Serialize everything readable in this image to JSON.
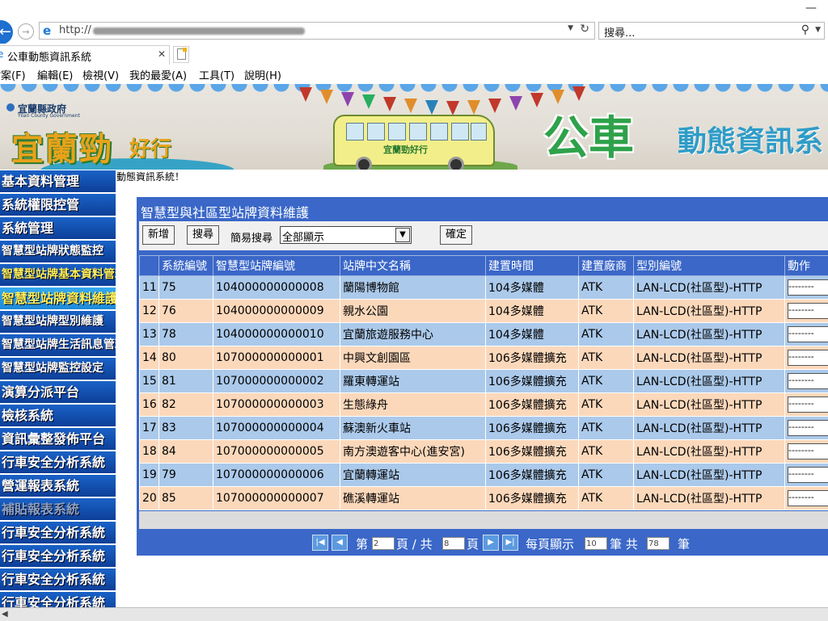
{
  "browser": {
    "address": {
      "prefix": "http://"
    },
    "search": {
      "placeholder": "搜尋..."
    },
    "tab": {
      "title": "公車動態資訊系統"
    },
    "menu": [
      "檔案(F)",
      "編輯(E)",
      "檢視(V)",
      "我的最愛(A)",
      "工具(T)",
      "說明(H)"
    ]
  },
  "banner": {
    "gov_name": "宜蘭縣政府",
    "gov_name_en": "Yilan County Government",
    "logo_main": "宜蘭",
    "logo_brand": "勁",
    "logo_sub": "好行",
    "bus_label": "宜蘭勁好行",
    "title_big": "公車",
    "title_rest": "動態資訊系"
  },
  "sidebar": {
    "items": [
      {
        "label": "基本資料管理",
        "style": "normal"
      },
      {
        "label": "系統權限控管",
        "style": "normal"
      },
      {
        "label": "系統管理",
        "style": "normal"
      },
      {
        "label": "智慧型站牌狀態監控",
        "style": "small"
      },
      {
        "label": "智慧型站牌基本資料管理",
        "style": "yellow-small"
      },
      {
        "label": "智慧型站牌資料維護",
        "style": "highlight"
      },
      {
        "label": "智慧型站牌型別維護",
        "style": "small"
      },
      {
        "label": "智慧型站牌生活訊息管理",
        "style": "small"
      },
      {
        "label": "智慧型站牌監控設定",
        "style": "small"
      },
      {
        "label": "演算分派平台",
        "style": "normal"
      },
      {
        "label": "檢核系統",
        "style": "normal"
      },
      {
        "label": "資訊彙整發佈平台",
        "style": "normal"
      },
      {
        "label": "行車安全分析系統",
        "style": "normal"
      },
      {
        "label": "營運報表系統",
        "style": "normal"
      },
      {
        "label": "補貼報表系統",
        "style": "disabled"
      },
      {
        "label": "行車安全分析系統",
        "style": "normal"
      },
      {
        "label": "行車安全分析系統",
        "style": "normal"
      },
      {
        "label": "行車安全分析系統",
        "style": "normal"
      },
      {
        "label": "行車安全分析系統",
        "style": "normal"
      }
    ]
  },
  "main": {
    "welcome": "動態資訊系統！",
    "panel_title": "智慧型與社區型站牌資料維護",
    "toolbar": {
      "add_label": "新增",
      "search_label": "搜尋",
      "quick_search_label": "簡易搜尋",
      "quick_search_value": "全部顯示",
      "confirm_label": "確定"
    },
    "table": {
      "headers": [
        "",
        "系統編號",
        "智慧型站牌編號",
        "站牌中文名稱",
        "建置時間",
        "建置廠商",
        "型別編號",
        "動作"
      ],
      "rows": [
        [
          "11",
          "75",
          "104000000000008",
          "蘭陽博物館",
          "104多媒體",
          "ATK",
          "LAN-LCD(社區型)-HTTP",
          "--------"
        ],
        [
          "12",
          "76",
          "104000000000009",
          "親水公園",
          "104多媒體",
          "ATK",
          "LAN-LCD(社區型)-HTTP",
          "--------"
        ],
        [
          "13",
          "78",
          "104000000000010",
          "宜蘭旅遊服務中心",
          "104多媒體",
          "ATK",
          "LAN-LCD(社區型)-HTTP",
          "--------"
        ],
        [
          "14",
          "80",
          "107000000000001",
          "中興文創園區",
          "106多媒體擴充",
          "ATK",
          "LAN-LCD(社區型)-HTTP",
          "--------"
        ],
        [
          "15",
          "81",
          "107000000000002",
          "羅東轉運站",
          "106多媒體擴充",
          "ATK",
          "LAN-LCD(社區型)-HTTP",
          "--------"
        ],
        [
          "16",
          "82",
          "107000000000003",
          "生態綠舟",
          "106多媒體擴充",
          "ATK",
          "LAN-LCD(社區型)-HTTP",
          "--------"
        ],
        [
          "17",
          "83",
          "107000000000004",
          "蘇澳新火車站",
          "106多媒體擴充",
          "ATK",
          "LAN-LCD(社區型)-HTTP",
          "--------"
        ],
        [
          "18",
          "84",
          "107000000000005",
          "南方澳遊客中心(進安宮)",
          "106多媒體擴充",
          "ATK",
          "LAN-LCD(社區型)-HTTP",
          "--------"
        ],
        [
          "19",
          "79",
          "107000000000006",
          "宜蘭轉運站",
          "106多媒體擴充",
          "ATK",
          "LAN-LCD(社區型)-HTTP",
          "--------"
        ],
        [
          "20",
          "85",
          "107000000000007",
          "礁溪轉運站",
          "106多媒體擴充",
          "ATK",
          "LAN-LCD(社區型)-HTTP",
          "--------"
        ]
      ]
    },
    "pager": {
      "page_prefix": "第",
      "page_value": "2",
      "page_suffix": "頁 / 共",
      "total_pages": "8",
      "total_suffix": "頁",
      "per_page_label": "每頁顯示",
      "per_page_value": "10",
      "records_unit": "筆 共",
      "total_records": "78",
      "records_suffix": "筆"
    }
  },
  "colors": {
    "panel_blue": "#3a67c8",
    "row_blue": "#abc9ea",
    "row_peach": "#fcd8bb",
    "nav_blue": "#1a62c7",
    "nav_yellow": "#ffef5a"
  }
}
